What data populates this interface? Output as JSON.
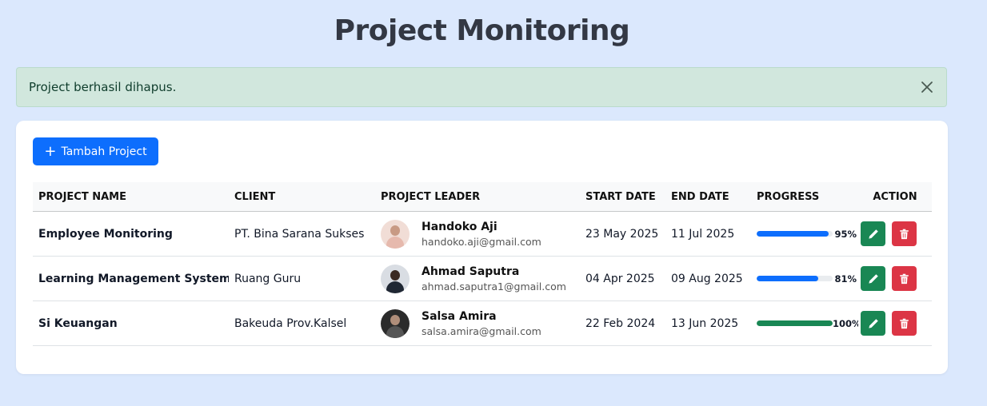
{
  "page": {
    "title": "Project Monitoring"
  },
  "alert": {
    "message": "Project berhasil dihapus.",
    "close_icon": "close-icon"
  },
  "toolbar": {
    "add_label": "Tambah Project",
    "add_icon": "plus-icon"
  },
  "table": {
    "headers": {
      "project_name": "PROJECT NAME",
      "client": "CLIENT",
      "project_leader": "PROJECT LEADER",
      "start_date": "START DATE",
      "end_date": "END DATE",
      "progress": "PROGRESS",
      "action": "ACTION"
    },
    "rows": [
      {
        "project_name": "Employee Monitoring",
        "client": "PT. Bina Sarana Sukses",
        "leader_name": "Handoko Aji",
        "leader_email": "handoko.aji@gmail.com",
        "start_date": "23 May 2025",
        "end_date": "11 Jul 2025",
        "progress": 95,
        "progress_label": "95%",
        "progress_color": "#0d6efd"
      },
      {
        "project_name": "Learning Management System",
        "client": "Ruang Guru",
        "leader_name": "Ahmad Saputra",
        "leader_email": "ahmad.saputra1@gmail.com",
        "start_date": "04 Apr 2025",
        "end_date": "09 Aug 2025",
        "progress": 81,
        "progress_label": "81%",
        "progress_color": "#0d6efd"
      },
      {
        "project_name": "Si Keuangan",
        "client": "Bakeuda Prov.Kalsel",
        "leader_name": "Salsa Amira",
        "leader_email": "salsa.amira@gmail.com",
        "start_date": "22 Feb 2024",
        "end_date": "13 Jun 2025",
        "progress": 100,
        "progress_label": "100%",
        "progress_color": "#198754"
      }
    ]
  },
  "colors": {
    "background": "#dbe8fd",
    "primary": "#0d6efd",
    "success": "#198754",
    "danger": "#dc3545",
    "alert_bg": "#d1e7dd"
  }
}
